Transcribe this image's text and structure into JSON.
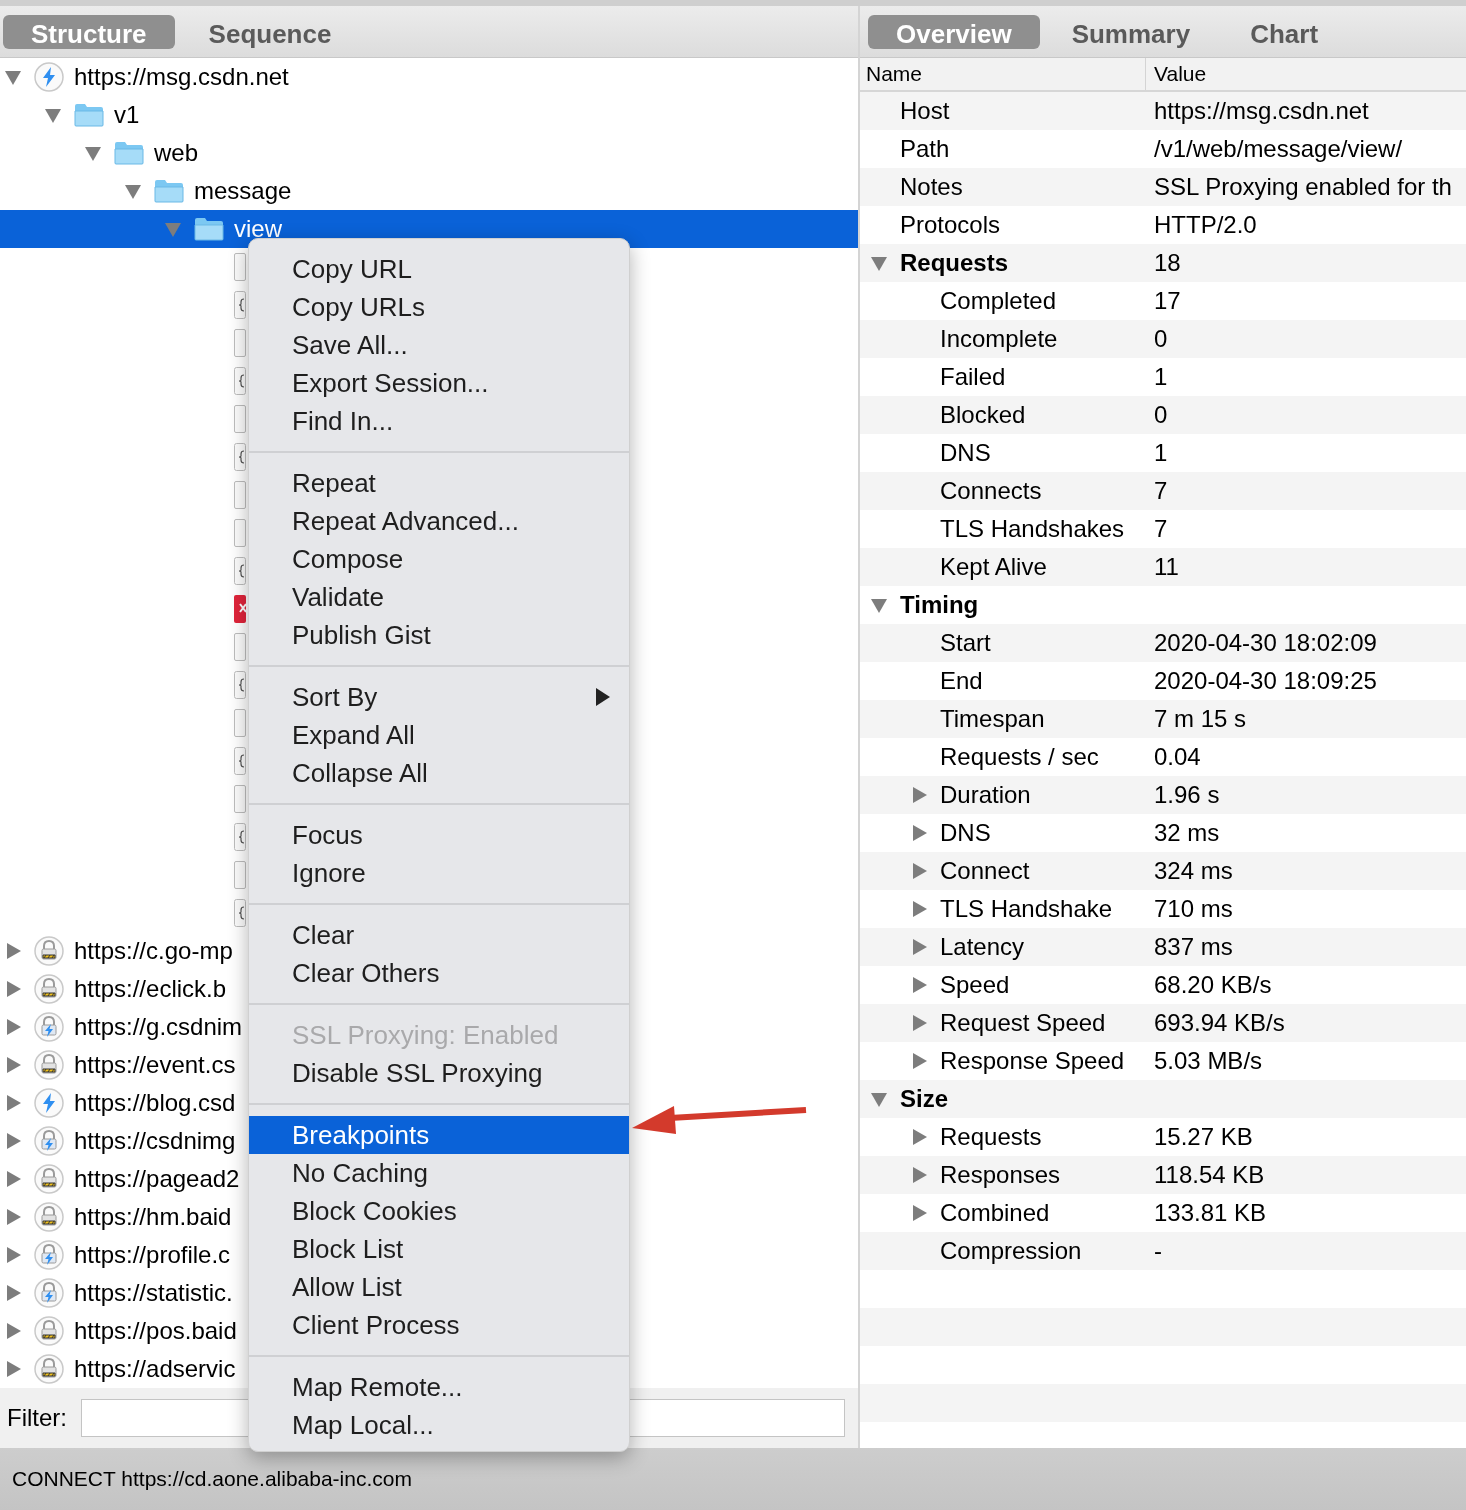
{
  "left_tabs": [
    {
      "label": "Structure",
      "selected": true
    },
    {
      "label": "Sequence",
      "selected": false
    }
  ],
  "tree": [
    {
      "label": "https://msg.csdn.net",
      "kind": "bolt",
      "expanded": true,
      "selected": false,
      "children": [
        {
          "label": "v1",
          "kind": "folder",
          "expanded": true,
          "selected": false,
          "children": [
            {
              "label": "web",
              "kind": "folder",
              "expanded": true,
              "selected": false,
              "children": [
                {
                  "label": "message",
                  "kind": "folder",
                  "expanded": true,
                  "selected": false,
                  "children": [
                    {
                      "label": "view",
                      "kind": "folder",
                      "expanded": true,
                      "selected": true,
                      "children": [
                        {
                          "kind": "doc",
                          "selected": false
                        },
                        {
                          "kind": "json",
                          "selected": false
                        },
                        {
                          "kind": "doc",
                          "selected": false
                        },
                        {
                          "kind": "json",
                          "selected": false
                        },
                        {
                          "kind": "doc",
                          "selected": false
                        },
                        {
                          "kind": "json",
                          "selected": false
                        },
                        {
                          "kind": "doc",
                          "selected": false
                        },
                        {
                          "kind": "doc",
                          "selected": false
                        },
                        {
                          "kind": "json",
                          "selected": false
                        },
                        {
                          "kind": "error",
                          "selected": false
                        },
                        {
                          "kind": "doc",
                          "selected": false
                        },
                        {
                          "kind": "json",
                          "selected": false
                        },
                        {
                          "kind": "doc",
                          "selected": false
                        },
                        {
                          "kind": "json",
                          "selected": false
                        },
                        {
                          "kind": "doc",
                          "selected": false
                        },
                        {
                          "kind": "json",
                          "selected": false
                        },
                        {
                          "kind": "doc",
                          "selected": false
                        },
                        {
                          "kind": "json",
                          "selected": false
                        }
                      ]
                    }
                  ]
                }
              ]
            }
          ]
        }
      ]
    },
    {
      "label": "https://c.go-mp",
      "kind": "lock",
      "expanded": false,
      "selected": false
    },
    {
      "label": "https://eclick.b",
      "kind": "lock",
      "expanded": false,
      "selected": false
    },
    {
      "label": "https://g.csdnim",
      "kind": "lock-bolt",
      "expanded": false,
      "selected": false
    },
    {
      "label": "https://event.cs",
      "kind": "lock",
      "expanded": false,
      "selected": false
    },
    {
      "label": "https://blog.csd",
      "kind": "bolt",
      "expanded": false,
      "selected": false
    },
    {
      "label": "https://csdnimg",
      "kind": "lock-bolt",
      "expanded": false,
      "selected": false
    },
    {
      "label": "https://pagead2",
      "kind": "lock",
      "expanded": false,
      "selected": false
    },
    {
      "label": "https://hm.baid",
      "kind": "lock",
      "expanded": false,
      "selected": false
    },
    {
      "label": "https://profile.c",
      "kind": "lock-bolt",
      "expanded": false,
      "selected": false
    },
    {
      "label": "https://statistic.",
      "kind": "lock-bolt",
      "expanded": false,
      "selected": false
    },
    {
      "label": "https://pos.baid",
      "kind": "lock",
      "expanded": false,
      "selected": false
    },
    {
      "label": "https://adservic",
      "kind": "lock",
      "expanded": false,
      "selected": false
    }
  ],
  "filter": {
    "label": "Filter:"
  },
  "context_menu": [
    [
      {
        "label": "Copy URL",
        "selected": false,
        "disabled": false,
        "submenu": false
      },
      {
        "label": "Copy URLs",
        "selected": false,
        "disabled": false,
        "submenu": false
      },
      {
        "label": "Save All...",
        "selected": false,
        "disabled": false,
        "submenu": false
      },
      {
        "label": "Export Session...",
        "selected": false,
        "disabled": false,
        "submenu": false
      },
      {
        "label": "Find In...",
        "selected": false,
        "disabled": false,
        "submenu": false
      }
    ],
    [
      {
        "label": "Repeat",
        "selected": false,
        "disabled": false,
        "submenu": false
      },
      {
        "label": "Repeat Advanced...",
        "selected": false,
        "disabled": false,
        "submenu": false
      },
      {
        "label": "Compose",
        "selected": false,
        "disabled": false,
        "submenu": false
      },
      {
        "label": "Validate",
        "selected": false,
        "disabled": false,
        "submenu": false
      },
      {
        "label": "Publish Gist",
        "selected": false,
        "disabled": false,
        "submenu": false
      }
    ],
    [
      {
        "label": "Sort By",
        "selected": false,
        "disabled": false,
        "submenu": true
      },
      {
        "label": "Expand All",
        "selected": false,
        "disabled": false,
        "submenu": false
      },
      {
        "label": "Collapse All",
        "selected": false,
        "disabled": false,
        "submenu": false
      }
    ],
    [
      {
        "label": "Focus",
        "selected": false,
        "disabled": false,
        "submenu": false
      },
      {
        "label": "Ignore",
        "selected": false,
        "disabled": false,
        "submenu": false
      }
    ],
    [
      {
        "label": "Clear",
        "selected": false,
        "disabled": false,
        "submenu": false
      },
      {
        "label": "Clear Others",
        "selected": false,
        "disabled": false,
        "submenu": false
      }
    ],
    [
      {
        "label": "SSL Proxying: Enabled",
        "selected": false,
        "disabled": true,
        "submenu": false
      },
      {
        "label": "Disable SSL Proxying",
        "selected": false,
        "disabled": false,
        "submenu": false
      }
    ],
    [
      {
        "label": "Breakpoints",
        "selected": true,
        "disabled": false,
        "submenu": false
      },
      {
        "label": "No Caching",
        "selected": false,
        "disabled": false,
        "submenu": false
      },
      {
        "label": "Block Cookies",
        "selected": false,
        "disabled": false,
        "submenu": false
      },
      {
        "label": "Block List",
        "selected": false,
        "disabled": false,
        "submenu": false
      },
      {
        "label": "Allow List",
        "selected": false,
        "disabled": false,
        "submenu": false
      },
      {
        "label": "Client Process",
        "selected": false,
        "disabled": false,
        "submenu": false
      }
    ],
    [
      {
        "label": "Map Remote...",
        "selected": false,
        "disabled": false,
        "submenu": false
      },
      {
        "label": "Map Local...",
        "selected": false,
        "disabled": false,
        "submenu": false
      }
    ]
  ],
  "right_tabs": [
    {
      "label": "Overview",
      "selected": true
    },
    {
      "label": "Summary",
      "selected": false
    },
    {
      "label": "Chart",
      "selected": false
    }
  ],
  "overview": {
    "columns": [
      "Name",
      "Value"
    ],
    "rows": [
      {
        "kind": "item",
        "name": "Host",
        "value": "https://msg.csdn.net"
      },
      {
        "kind": "item",
        "name": "Path",
        "value": "/v1/web/message/view/"
      },
      {
        "kind": "item",
        "name": "Notes",
        "value": "SSL Proxying enabled for th"
      },
      {
        "kind": "item",
        "name": "Protocols",
        "value": "HTTP/2.0"
      },
      {
        "kind": "group",
        "name": "Requests",
        "value": "18",
        "expanded": true,
        "children": [
          {
            "kind": "item",
            "name": "Completed",
            "value": "17"
          },
          {
            "kind": "item",
            "name": "Incomplete",
            "value": "0"
          },
          {
            "kind": "item",
            "name": "Failed",
            "value": "1"
          },
          {
            "kind": "item",
            "name": "Blocked",
            "value": "0"
          },
          {
            "kind": "item",
            "name": "DNS",
            "value": "1"
          },
          {
            "kind": "item",
            "name": "Connects",
            "value": "7"
          },
          {
            "kind": "item",
            "name": "TLS Handshakes",
            "value": "7"
          },
          {
            "kind": "item",
            "name": "Kept Alive",
            "value": "11"
          }
        ]
      },
      {
        "kind": "group",
        "name": "Timing",
        "expanded": true,
        "children": [
          {
            "kind": "item",
            "name": "Start",
            "value": "2020-04-30 18:02:09"
          },
          {
            "kind": "item",
            "name": "End",
            "value": "2020-04-30 18:09:25"
          },
          {
            "kind": "item",
            "name": "Timespan",
            "value": "7 m 15 s"
          },
          {
            "kind": "item",
            "name": "Requests / sec",
            "value": "0.04"
          },
          {
            "kind": "item",
            "name": "Duration",
            "value": "1.96 s",
            "expanded": false
          },
          {
            "kind": "item",
            "name": "DNS",
            "value": "32 ms",
            "expanded": false
          },
          {
            "kind": "item",
            "name": "Connect",
            "value": "324 ms",
            "expanded": false
          },
          {
            "kind": "item",
            "name": "TLS Handshake",
            "value": "710 ms",
            "expanded": false
          },
          {
            "kind": "item",
            "name": "Latency",
            "value": "837 ms",
            "expanded": false
          },
          {
            "kind": "item",
            "name": "Speed",
            "value": "68.20 KB/s",
            "expanded": false
          },
          {
            "kind": "item",
            "name": "Request Speed",
            "value": "693.94 KB/s",
            "expanded": false
          },
          {
            "kind": "item",
            "name": "Response Speed",
            "value": "5.03 MB/s",
            "expanded": false
          }
        ]
      },
      {
        "kind": "group",
        "name": "Size",
        "expanded": true,
        "children": [
          {
            "kind": "item",
            "name": "Requests",
            "value": "15.27 KB",
            "expanded": false
          },
          {
            "kind": "item",
            "name": "Responses",
            "value": "118.54 KB",
            "expanded": false
          },
          {
            "kind": "item",
            "name": "Combined",
            "value": "133.81 KB",
            "expanded": false
          },
          {
            "kind": "item",
            "name": "Compression",
            "value": "-"
          }
        ]
      }
    ]
  },
  "status_bar": {
    "text": "CONNECT https://cd.aone.alibaba-inc.com"
  }
}
